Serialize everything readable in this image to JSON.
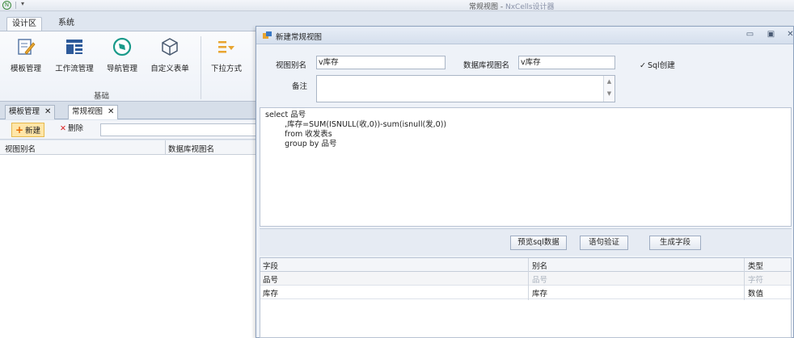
{
  "window": {
    "app_icon": "app-logo-icon",
    "title_main": "常规视图 - ",
    "title_sub": "NxCells设计器"
  },
  "ribbon": {
    "tabs": [
      {
        "label": "设计区",
        "active": true
      },
      {
        "label": "系统",
        "active": false
      }
    ],
    "buttons": [
      {
        "label": "模板管理",
        "icon": "template-edit-icon"
      },
      {
        "label": "工作流管理",
        "icon": "workflow-icon"
      },
      {
        "label": "导航管理",
        "icon": "compass-icon"
      },
      {
        "label": "自定义表单",
        "icon": "cube-icon"
      },
      {
        "label": "下拉方式",
        "icon": "dropdown-list-icon"
      }
    ],
    "group_label": "基础"
  },
  "doc_tabs": [
    {
      "label": "模板管理",
      "active": false
    },
    {
      "label": "常规视图",
      "active": true
    }
  ],
  "toolbar": {
    "new_label": "新建",
    "delete_label": "删除",
    "search_value": ""
  },
  "left_grid": {
    "columns": [
      "视图别名",
      "数据库视图名"
    ]
  },
  "dialog": {
    "title": "新建常规视图",
    "alias_label": "视图别名",
    "alias_value": "v库存",
    "db_view_label": "数据库视图名",
    "db_view_value": "v库存",
    "sql_create_label": "Sql创建",
    "sql_create_checked": true,
    "note_label": "备注",
    "note_value": "",
    "sql_lines": [
      "select 品号",
      "        ,库存=SUM(ISNULL(收,0))-sum(isnull(发,0))",
      "        from 收发表s",
      "        group by 品号"
    ],
    "buttons": {
      "preview": "预览sql数据",
      "validate": "语句验证",
      "generate": "生成字段"
    },
    "fields_grid": {
      "columns": [
        "字段",
        "别名",
        "类型"
      ],
      "rows": [
        {
          "field": "品号",
          "alias": "品号",
          "type": "字符"
        },
        {
          "field": "库存",
          "alias": "库存",
          "type": "数值"
        }
      ]
    }
  },
  "colors": {
    "accent_orange": "#e56a00",
    "delete_red": "#d22222",
    "ribbon_bg": "#dfe6f0"
  }
}
